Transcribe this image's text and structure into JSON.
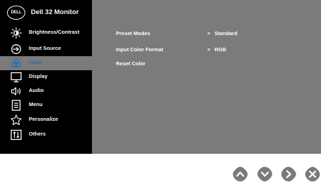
{
  "osd": {
    "brand_logo": "DELL",
    "model": "Dell 32 Monitor",
    "menu": [
      {
        "label": "Brightness/Contrast",
        "icon": "brightness-icon"
      },
      {
        "label": "Input Source",
        "icon": "input-source-icon"
      },
      {
        "label": "Color",
        "icon": "color-icon",
        "selected": true
      },
      {
        "label": "Display",
        "icon": "display-icon"
      },
      {
        "label": "Audio",
        "icon": "audio-icon"
      },
      {
        "label": "Menu",
        "icon": "menu-icon"
      },
      {
        "label": "Personalize",
        "icon": "star-icon"
      },
      {
        "label": "Others",
        "icon": "others-icon"
      }
    ],
    "color_submenu": [
      {
        "label": "Preset Modes",
        "value": "Standard"
      },
      {
        "label": "Input Color Format",
        "value": "RGB"
      },
      {
        "label": "Reset Color",
        "value": ""
      }
    ]
  },
  "buttons": [
    {
      "name": "up-button",
      "icon": "chevron-up-icon"
    },
    {
      "name": "down-button",
      "icon": "chevron-down-icon"
    },
    {
      "name": "right-button",
      "icon": "chevron-right-icon"
    },
    {
      "name": "close-button",
      "icon": "close-icon"
    }
  ],
  "colors": {
    "sidebar_bg": "#000000",
    "panel_bg": "#7b7b7b",
    "selected_text": "#1e6fb4",
    "button_fill": "#7a7a7a"
  }
}
